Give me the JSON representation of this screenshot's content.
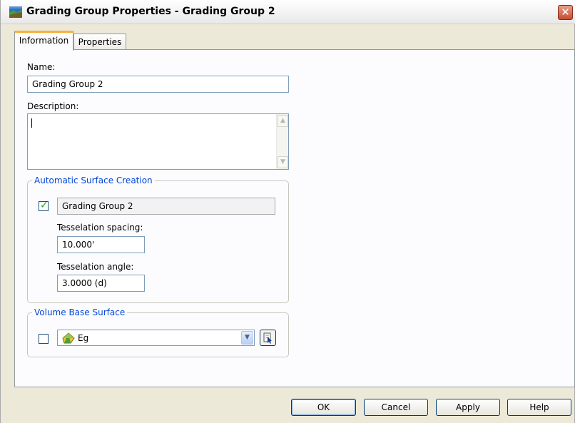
{
  "window": {
    "title": "Grading Group Properties - Grading Group 2",
    "close_glyph": "✕"
  },
  "tabs": [
    {
      "label": "Information",
      "active": true
    },
    {
      "label": "Properties",
      "active": false
    }
  ],
  "information": {
    "name_label": "Name:",
    "name_value": "Grading Group 2",
    "description_label": "Description:",
    "description_value": ""
  },
  "auto_surface": {
    "legend": "Automatic Surface Creation",
    "checked": true,
    "surface_name": "Grading Group 2",
    "spacing_label": "Tesselation spacing:",
    "spacing_value": "10.000'",
    "angle_label": "Tesselation angle:",
    "angle_value": "3.0000 (d)"
  },
  "volume_base": {
    "legend": "Volume Base Surface",
    "checked": false,
    "selected_surface": "Eg",
    "surface_icon": "surface-icon",
    "pick_icon": "pick-from-drawing-icon"
  },
  "buttons": {
    "ok": "OK",
    "cancel": "Cancel",
    "apply": "Apply",
    "help": "Help"
  },
  "colors": {
    "group_legend": "#0046d5",
    "active_tab_accent": "#f8b13c",
    "check_mark": "#21a121"
  }
}
